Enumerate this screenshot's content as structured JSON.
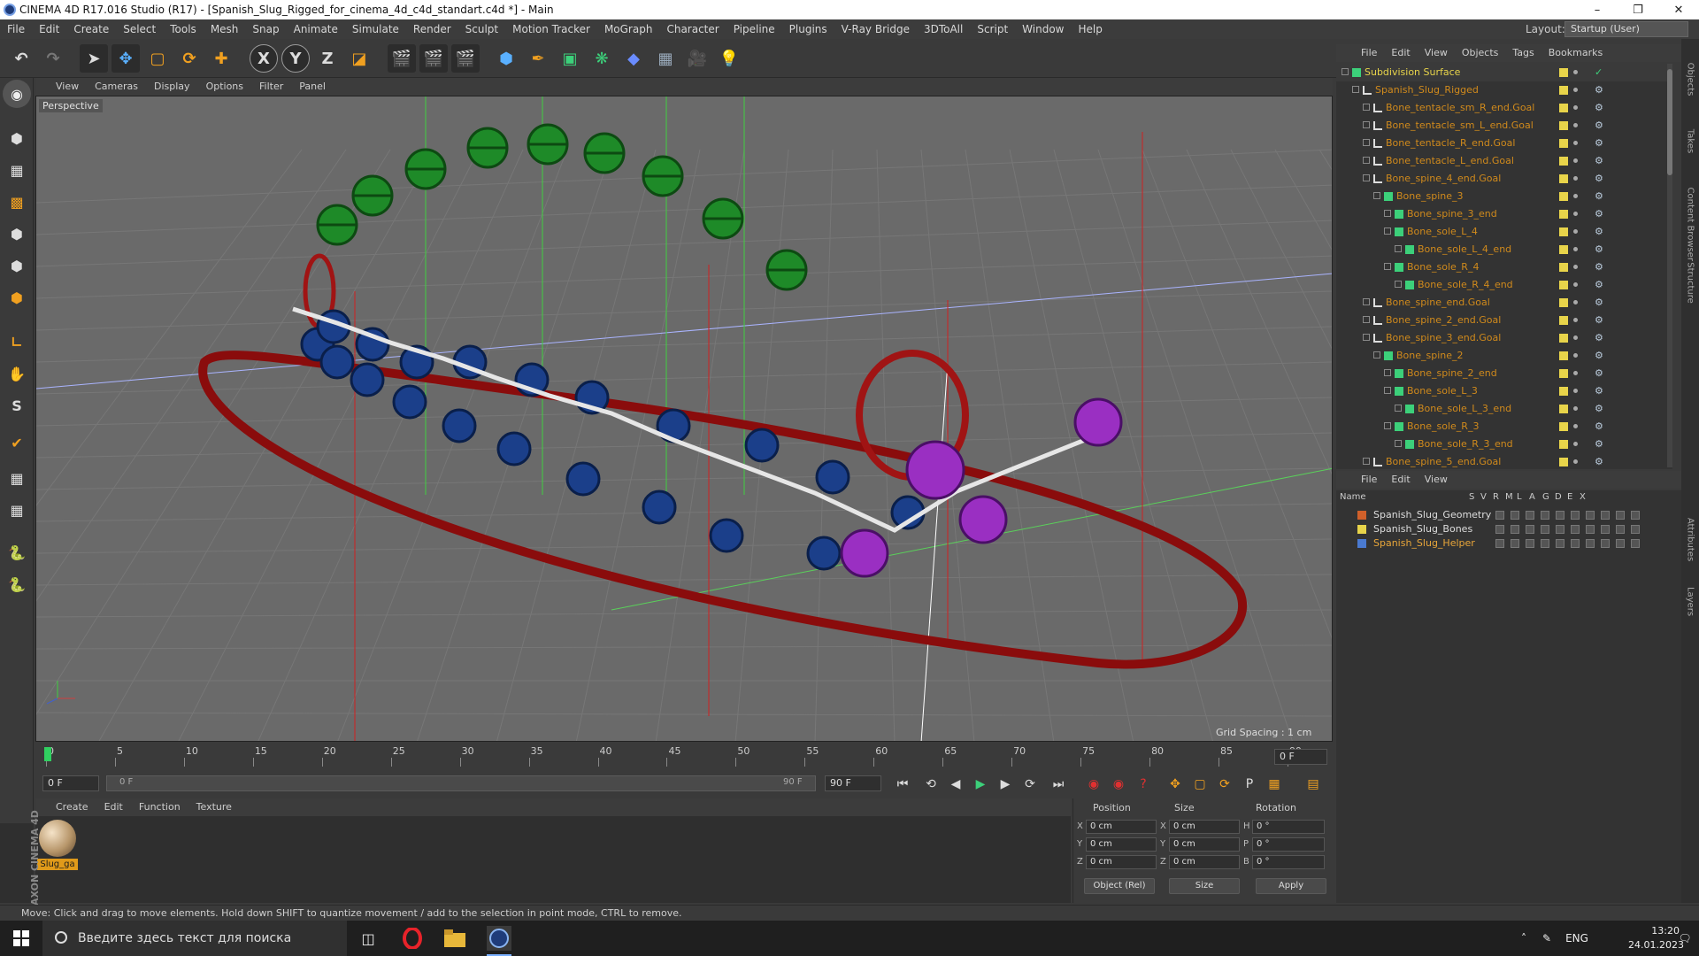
{
  "window": {
    "title": "CINEMA 4D R17.016 Studio (R17) - [Spanish_Slug_Rigged_for_cinema_4d_c4d_standart.c4d *] - Main"
  },
  "menubar": [
    "File",
    "Edit",
    "Create",
    "Select",
    "Tools",
    "Mesh",
    "Snap",
    "Animate",
    "Simulate",
    "Render",
    "Sculpt",
    "Motion Tracker",
    "MoGraph",
    "Character",
    "Pipeline",
    "Plugins",
    "V-Ray Bridge",
    "3DToAll",
    "Script",
    "Window",
    "Help"
  ],
  "layout": {
    "label": "Layout:",
    "value": "Startup (User)"
  },
  "toolbar": {
    "x_label": "X",
    "y_label": "Y",
    "z_label": "Z"
  },
  "viewport": {
    "menu": [
      "View",
      "Cameras",
      "Display",
      "Options",
      "Filter",
      "Panel"
    ],
    "camera_label": "Perspective",
    "grid_spacing": "Grid Spacing : 1 cm"
  },
  "timeline": {
    "ticks": [
      "0",
      "5",
      "10",
      "15",
      "20",
      "25",
      "30",
      "35",
      "40",
      "45",
      "50",
      "55",
      "60",
      "65",
      "70",
      "75",
      "80",
      "85",
      "90"
    ],
    "current_frame": "0 F",
    "start_field": "0 F",
    "range_start": "0 F",
    "range_end": "90 F",
    "end_field": "90 F"
  },
  "material_manager": {
    "menu": [
      "Create",
      "Edit",
      "Function",
      "Texture"
    ],
    "material_name": "Slug_ga",
    "brand": "MAXON CINEMA 4D"
  },
  "coordinates": {
    "headers": {
      "position": "Position",
      "size": "Size",
      "rotation": "Rotation"
    },
    "rows": [
      {
        "axis": "X",
        "pos": "0 cm",
        "size_axis": "X",
        "size": "0 cm",
        "rot_axis": "H",
        "rot": "0 °"
      },
      {
        "axis": "Y",
        "pos": "0 cm",
        "size_axis": "Y",
        "size": "0 cm",
        "rot_axis": "P",
        "rot": "0 °"
      },
      {
        "axis": "Z",
        "pos": "0 cm",
        "size_axis": "Z",
        "size": "0 cm",
        "rot_axis": "B",
        "rot": "0 °"
      }
    ],
    "mode": "Object (Rel)",
    "size_mode": "Size",
    "apply": "Apply"
  },
  "status_text": "Move: Click and drag to move elements. Hold down SHIFT to quantize movement / add to the selection in point mode, CTRL to remove.",
  "object_manager": {
    "menu": [
      "File",
      "Edit",
      "View",
      "Objects",
      "Tags",
      "Bookmarks"
    ],
    "items": [
      {
        "name": "Subdivision Surface",
        "indent": 0,
        "color": "#e8d44a",
        "type": "subdiv"
      },
      {
        "name": "Spanish_Slug_Rigged",
        "indent": 1,
        "color": "#d08a1c",
        "type": "null"
      },
      {
        "name": "Bone_tentacle_sm_R_end.Goal",
        "indent": 2,
        "color": "#d08a1c",
        "type": "null"
      },
      {
        "name": "Bone_tentacle_sm_L_end.Goal",
        "indent": 2,
        "color": "#d08a1c",
        "type": "null"
      },
      {
        "name": "Bone_tentacle_R_end.Goal",
        "indent": 2,
        "color": "#d08a1c",
        "type": "null"
      },
      {
        "name": "Bone_tentacle_L_end.Goal",
        "indent": 2,
        "color": "#d08a1c",
        "type": "null"
      },
      {
        "name": "Bone_spine_4_end.Goal",
        "indent": 2,
        "color": "#d08a1c",
        "type": "null"
      },
      {
        "name": "Bone_spine_3",
        "indent": 3,
        "color": "#d08a1c",
        "type": "bone"
      },
      {
        "name": "Bone_spine_3_end",
        "indent": 4,
        "color": "#d08a1c",
        "type": "bone"
      },
      {
        "name": "Bone_sole_L_4",
        "indent": 4,
        "color": "#d08a1c",
        "type": "bone"
      },
      {
        "name": "Bone_sole_L_4_end",
        "indent": 5,
        "color": "#d08a1c",
        "type": "bone"
      },
      {
        "name": "Bone_sole_R_4",
        "indent": 4,
        "color": "#d08a1c",
        "type": "bone"
      },
      {
        "name": "Bone_sole_R_4_end",
        "indent": 5,
        "color": "#d08a1c",
        "type": "bone"
      },
      {
        "name": "Bone_spine_end.Goal",
        "indent": 2,
        "color": "#d08a1c",
        "type": "null"
      },
      {
        "name": "Bone_spine_2_end.Goal",
        "indent": 2,
        "color": "#d08a1c",
        "type": "null"
      },
      {
        "name": "Bone_spine_3_end.Goal",
        "indent": 2,
        "color": "#d08a1c",
        "type": "null"
      },
      {
        "name": "Bone_spine_2",
        "indent": 3,
        "color": "#d08a1c",
        "type": "bone"
      },
      {
        "name": "Bone_spine_2_end",
        "indent": 4,
        "color": "#d08a1c",
        "type": "bone"
      },
      {
        "name": "Bone_sole_L_3",
        "indent": 4,
        "color": "#d08a1c",
        "type": "bone"
      },
      {
        "name": "Bone_sole_L_3_end",
        "indent": 5,
        "color": "#d08a1c",
        "type": "bone"
      },
      {
        "name": "Bone_sole_R_3",
        "indent": 4,
        "color": "#d08a1c",
        "type": "bone"
      },
      {
        "name": "Bone_sole_R_3_end",
        "indent": 5,
        "color": "#d08a1c",
        "type": "bone"
      },
      {
        "name": "Bone_spine_5_end.Goal",
        "indent": 2,
        "color": "#d08a1c",
        "type": "null"
      }
    ]
  },
  "layer_manager": {
    "menu": [
      "File",
      "Edit",
      "View"
    ],
    "columns": [
      "Name",
      "S",
      "V",
      "R",
      "M",
      "L",
      "A",
      "G",
      "D",
      "E",
      "X"
    ],
    "layers": [
      {
        "name": "Spanish_Slug_Geometry",
        "color": "#d0602a"
      },
      {
        "name": "Spanish_Slug_Bones",
        "color": "#e8d44a"
      },
      {
        "name": "Spanish_Slug_Helper",
        "color": "#4a7ad0"
      }
    ]
  },
  "side_tabs": [
    "Objects",
    "Takes",
    "Content Browser",
    "Structure",
    "Attributes",
    "Layers"
  ],
  "taskbar": {
    "search_placeholder": "Введите здесь текст для поиска",
    "lang": "ENG",
    "time": "13:20",
    "date": "24.01.2023"
  },
  "colors": {
    "bg": "#3a3a3a",
    "viewport": "#6a6a6a",
    "accent_orange": "#d08a1c",
    "bone_blue": "#1b3f8a",
    "bone_purple": "#9a2fc2",
    "helper_green": "#1e8a28",
    "helper_red": "#9a1010"
  }
}
